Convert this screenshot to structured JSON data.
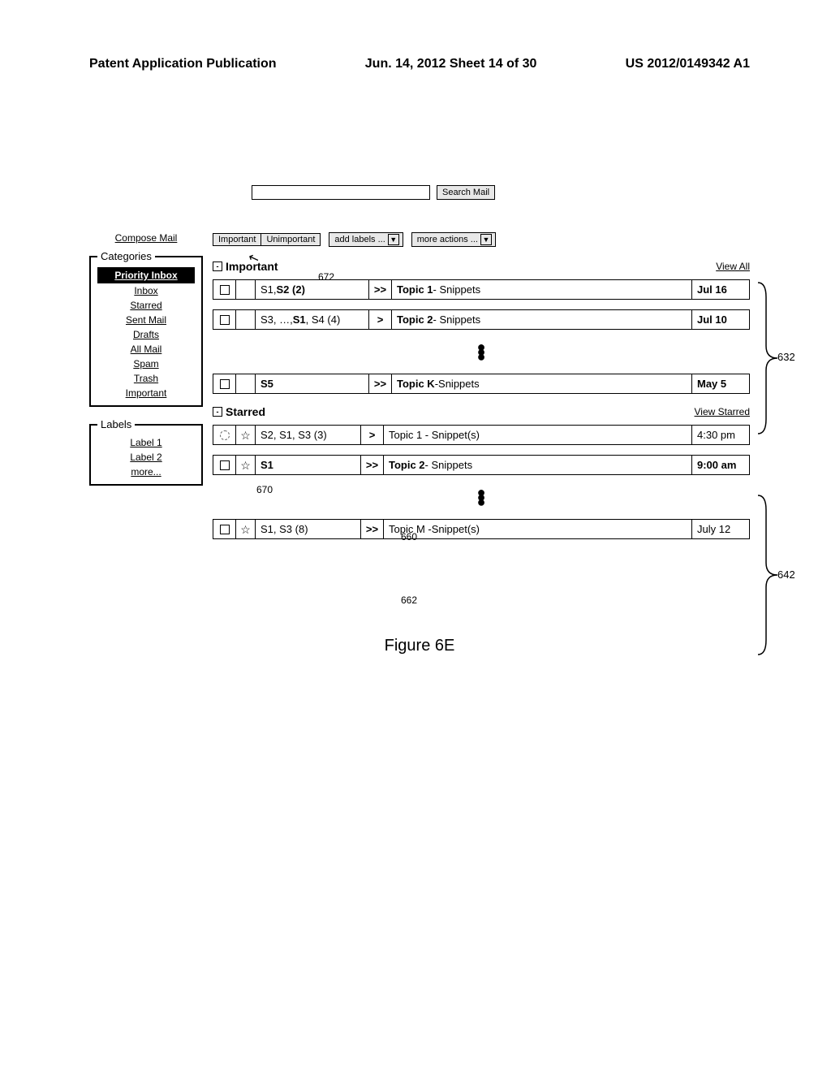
{
  "pub_header": {
    "left": "Patent Application Publication",
    "center": "Jun. 14, 2012  Sheet 14 of 30",
    "right": "US 2012/0149342 A1"
  },
  "search": {
    "placeholder": "",
    "button": "Search Mail"
  },
  "compose": "Compose Mail",
  "sidebar": {
    "categories_legend": "Categories",
    "items": [
      "Priority Inbox",
      "Inbox",
      "Starred",
      "Sent Mail",
      "Drafts",
      "All Mail",
      "Spam",
      "Trash",
      "Important"
    ],
    "labels_legend": "Labels",
    "labels": [
      "Label 1",
      "Label 2",
      "more..."
    ]
  },
  "actions": {
    "important": "Important",
    "unimportant": "Unimportant",
    "add_labels": "add labels ...",
    "more_actions": "more actions ..."
  },
  "sections": {
    "important": {
      "title": "Important",
      "view": "View All",
      "rows": [
        {
          "senders_html": "S1, <b>S2 (2)</b>",
          "imp": ">>",
          "subject_html": "<b>Topic 1</b> - Snippets",
          "date": "Jul 16"
        },
        {
          "senders_html": "S3, …, <b>S1</b>, S4 (4)",
          "imp": ">",
          "subject_html": "<b>Topic 2</b> - Snippets",
          "date": "Jul 10"
        },
        {
          "senders_html": "<b>S5</b>",
          "imp": ">>",
          "subject_html": "<b>Topic K</b>-Snippets",
          "date": "May 5"
        }
      ]
    },
    "starred": {
      "title": "Starred",
      "view": "View Starred",
      "rows": [
        {
          "checked_style": "dotted",
          "star": "☆",
          "senders": "S2, S1, S3 (3)",
          "imp": ">",
          "subject": "Topic 1 - Snippet(s)",
          "date": "4:30 pm",
          "date_bold": false
        },
        {
          "checked_style": "solid",
          "star": "☆",
          "senders": "S1",
          "imp": ">>",
          "subject_html": "<b>Topic 2</b> - Snippets",
          "date": "9:00 am",
          "date_bold": true,
          "senders_bold": true
        },
        {
          "checked_style": "solid",
          "star": "☆",
          "senders": "S1, S3 (8)",
          "imp": ">>",
          "subject": "Topic M -Snippet(s)",
          "date": "July 12",
          "date_bold": false
        }
      ]
    }
  },
  "callouts": {
    "c672": "672",
    "c670": "670",
    "c660": "660",
    "c662": "662",
    "c632": "632",
    "c642": "642"
  },
  "figcap": "Figure 6E"
}
